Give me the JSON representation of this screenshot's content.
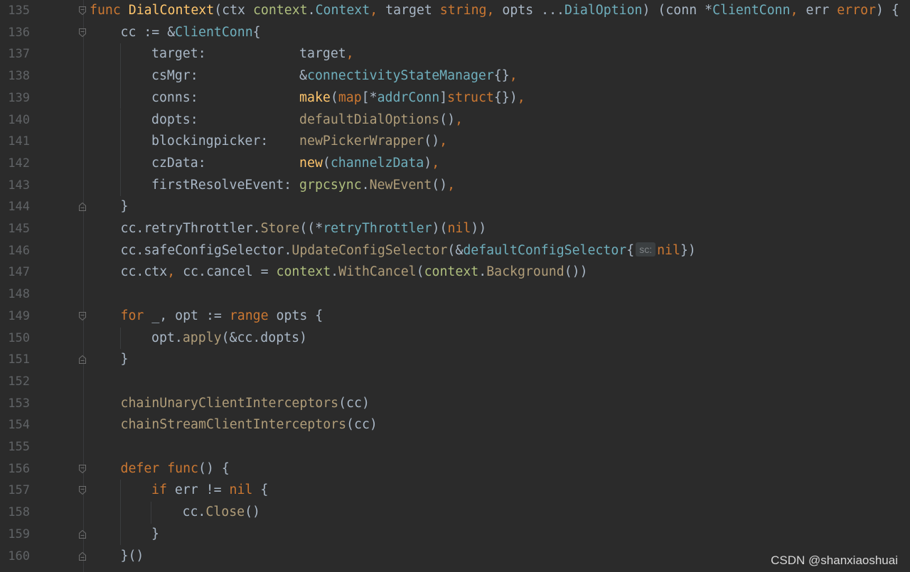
{
  "editor": {
    "lines": [
      {
        "num": "135",
        "indent": 0,
        "fold": "start",
        "tokens": [
          {
            "t": "func ",
            "c": "kw"
          },
          {
            "t": "DialContext",
            "c": "fn"
          },
          {
            "t": "(ctx ",
            "c": "id"
          },
          {
            "t": "context",
            "c": "pkg"
          },
          {
            "t": ".",
            "c": "id"
          },
          {
            "t": "Context",
            "c": "ty"
          },
          {
            "t": ", ",
            "c": "kw"
          },
          {
            "t": "target ",
            "c": "id"
          },
          {
            "t": "string",
            "c": "kw"
          },
          {
            "t": ", ",
            "c": "kw"
          },
          {
            "t": "opts ...",
            "c": "id"
          },
          {
            "t": "DialOption",
            "c": "ty"
          },
          {
            "t": ") (conn *",
            "c": "id"
          },
          {
            "t": "ClientConn",
            "c": "ty"
          },
          {
            "t": ", ",
            "c": "kw"
          },
          {
            "t": "err ",
            "c": "id"
          },
          {
            "t": "error",
            "c": "kw"
          },
          {
            "t": ") {",
            "c": "id"
          }
        ]
      },
      {
        "num": "136",
        "indent": 1,
        "fold": "start",
        "tokens": [
          {
            "t": "cc := &",
            "c": "id"
          },
          {
            "t": "ClientConn",
            "c": "ty"
          },
          {
            "t": "{",
            "c": "id"
          }
        ]
      },
      {
        "num": "137",
        "indent": 2,
        "fold": "",
        "tokens": [
          {
            "t": "target:            target",
            "c": "id"
          },
          {
            "t": ",",
            "c": "kw"
          }
        ]
      },
      {
        "num": "138",
        "indent": 2,
        "fold": "",
        "tokens": [
          {
            "t": "csMgr:             &",
            "c": "id"
          },
          {
            "t": "connectivityStateManager",
            "c": "ty"
          },
          {
            "t": "{}",
            "c": "id"
          },
          {
            "t": ",",
            "c": "kw"
          }
        ]
      },
      {
        "num": "139",
        "indent": 2,
        "fold": "",
        "tokens": [
          {
            "t": "conns:             ",
            "c": "id"
          },
          {
            "t": "make",
            "c": "fn"
          },
          {
            "t": "(",
            "c": "id"
          },
          {
            "t": "map",
            "c": "kw"
          },
          {
            "t": "[*",
            "c": "id"
          },
          {
            "t": "addrConn",
            "c": "ty"
          },
          {
            "t": "]",
            "c": "id"
          },
          {
            "t": "struct",
            "c": "kw"
          },
          {
            "t": "{})",
            "c": "id"
          },
          {
            "t": ",",
            "c": "kw"
          }
        ]
      },
      {
        "num": "140",
        "indent": 2,
        "fold": "",
        "tokens": [
          {
            "t": "dopts:             ",
            "c": "id"
          },
          {
            "t": "defaultDialOptions",
            "c": "mcall"
          },
          {
            "t": "()",
            "c": "id"
          },
          {
            "t": ",",
            "c": "kw"
          }
        ]
      },
      {
        "num": "141",
        "indent": 2,
        "fold": "",
        "tokens": [
          {
            "t": "blockingpicker:    ",
            "c": "id"
          },
          {
            "t": "newPickerWrapper",
            "c": "mcall"
          },
          {
            "t": "()",
            "c": "id"
          },
          {
            "t": ",",
            "c": "kw"
          }
        ]
      },
      {
        "num": "142",
        "indent": 2,
        "fold": "",
        "tokens": [
          {
            "t": "czData:            ",
            "c": "id"
          },
          {
            "t": "new",
            "c": "fn"
          },
          {
            "t": "(",
            "c": "id"
          },
          {
            "t": "channelzData",
            "c": "ty"
          },
          {
            "t": ")",
            "c": "id"
          },
          {
            "t": ",",
            "c": "kw"
          }
        ]
      },
      {
        "num": "143",
        "indent": 2,
        "fold": "",
        "tokens": [
          {
            "t": "firstResolveEvent: ",
            "c": "id"
          },
          {
            "t": "grpcsync",
            "c": "pkg"
          },
          {
            "t": ".",
            "c": "id"
          },
          {
            "t": "NewEvent",
            "c": "mcall"
          },
          {
            "t": "()",
            "c": "id"
          },
          {
            "t": ",",
            "c": "kw"
          }
        ]
      },
      {
        "num": "144",
        "indent": 1,
        "fold": "end",
        "tokens": [
          {
            "t": "}",
            "c": "id"
          }
        ]
      },
      {
        "num": "145",
        "indent": 1,
        "fold": "",
        "tokens": [
          {
            "t": "cc.retryThrottler.",
            "c": "id"
          },
          {
            "t": "Store",
            "c": "mcall"
          },
          {
            "t": "((*",
            "c": "id"
          },
          {
            "t": "retryThrottler",
            "c": "ty"
          },
          {
            "t": ")(",
            "c": "id"
          },
          {
            "t": "nil",
            "c": "kw"
          },
          {
            "t": "))",
            "c": "id"
          }
        ]
      },
      {
        "num": "146",
        "indent": 1,
        "fold": "",
        "tokens": [
          {
            "t": "cc.safeConfigSelector.",
            "c": "id"
          },
          {
            "t": "UpdateConfigSelector",
            "c": "mcall"
          },
          {
            "t": "(&",
            "c": "id"
          },
          {
            "t": "defaultConfigSelector",
            "c": "ty"
          },
          {
            "t": "{",
            "c": "id"
          },
          {
            "t": "sc:",
            "c": "hint"
          },
          {
            "t": "nil",
            "c": "kw"
          },
          {
            "t": "})",
            "c": "id"
          }
        ]
      },
      {
        "num": "147",
        "indent": 1,
        "fold": "",
        "tokens": [
          {
            "t": "cc.ctx",
            "c": "id"
          },
          {
            "t": ", ",
            "c": "kw"
          },
          {
            "t": "cc.cancel = ",
            "c": "id"
          },
          {
            "t": "context",
            "c": "pkg"
          },
          {
            "t": ".",
            "c": "id"
          },
          {
            "t": "WithCancel",
            "c": "mcall"
          },
          {
            "t": "(",
            "c": "id"
          },
          {
            "t": "context",
            "c": "pkg"
          },
          {
            "t": ".",
            "c": "id"
          },
          {
            "t": "Background",
            "c": "mcall"
          },
          {
            "t": "())",
            "c": "id"
          }
        ]
      },
      {
        "num": "148",
        "indent": 1,
        "fold": "",
        "tokens": []
      },
      {
        "num": "149",
        "indent": 1,
        "fold": "start",
        "tokens": [
          {
            "t": "for ",
            "c": "kw"
          },
          {
            "t": "_, opt := ",
            "c": "id"
          },
          {
            "t": "range ",
            "c": "kw"
          },
          {
            "t": "opts {",
            "c": "id"
          }
        ]
      },
      {
        "num": "150",
        "indent": 2,
        "fold": "",
        "tokens": [
          {
            "t": "opt.",
            "c": "id"
          },
          {
            "t": "apply",
            "c": "mcall"
          },
          {
            "t": "(&cc.dopts)",
            "c": "id"
          }
        ]
      },
      {
        "num": "151",
        "indent": 1,
        "fold": "end",
        "tokens": [
          {
            "t": "}",
            "c": "id"
          }
        ]
      },
      {
        "num": "152",
        "indent": 1,
        "fold": "",
        "tokens": []
      },
      {
        "num": "153",
        "indent": 1,
        "fold": "",
        "tokens": [
          {
            "t": "chainUnaryClientInterceptors",
            "c": "mcall"
          },
          {
            "t": "(cc)",
            "c": "id"
          }
        ]
      },
      {
        "num": "154",
        "indent": 1,
        "fold": "",
        "tokens": [
          {
            "t": "chainStreamClientInterceptors",
            "c": "mcall"
          },
          {
            "t": "(cc)",
            "c": "id"
          }
        ]
      },
      {
        "num": "155",
        "indent": 1,
        "fold": "",
        "tokens": []
      },
      {
        "num": "156",
        "indent": 1,
        "fold": "start",
        "tokens": [
          {
            "t": "defer ",
            "c": "kw"
          },
          {
            "t": "func",
            "c": "kw"
          },
          {
            "t": "() {",
            "c": "id"
          }
        ]
      },
      {
        "num": "157",
        "indent": 2,
        "fold": "start",
        "tokens": [
          {
            "t": "if ",
            "c": "kw"
          },
          {
            "t": "err != ",
            "c": "id"
          },
          {
            "t": "nil ",
            "c": "kw"
          },
          {
            "t": "{",
            "c": "id"
          }
        ]
      },
      {
        "num": "158",
        "indent": 3,
        "fold": "",
        "tokens": [
          {
            "t": "cc.",
            "c": "id"
          },
          {
            "t": "Close",
            "c": "mcall"
          },
          {
            "t": "()",
            "c": "id"
          }
        ]
      },
      {
        "num": "159",
        "indent": 2,
        "fold": "end",
        "tokens": [
          {
            "t": "}",
            "c": "id"
          }
        ]
      },
      {
        "num": "160",
        "indent": 1,
        "fold": "end",
        "tokens": [
          {
            "t": "}()",
            "c": "id"
          }
        ]
      }
    ]
  },
  "colors": {
    "background": "#2b2b2b",
    "keyword": "#cc7832",
    "function": "#ffc66d",
    "type": "#6fafbd",
    "package": "#afbf7e",
    "method": "#b09d79",
    "identifier": "#a9b7c6",
    "line_number": "#606366"
  },
  "icons": {
    "fold_start": "fold-open-icon",
    "fold_end": "fold-end-icon"
  },
  "watermark": "CSDN @shanxiaoshuai"
}
